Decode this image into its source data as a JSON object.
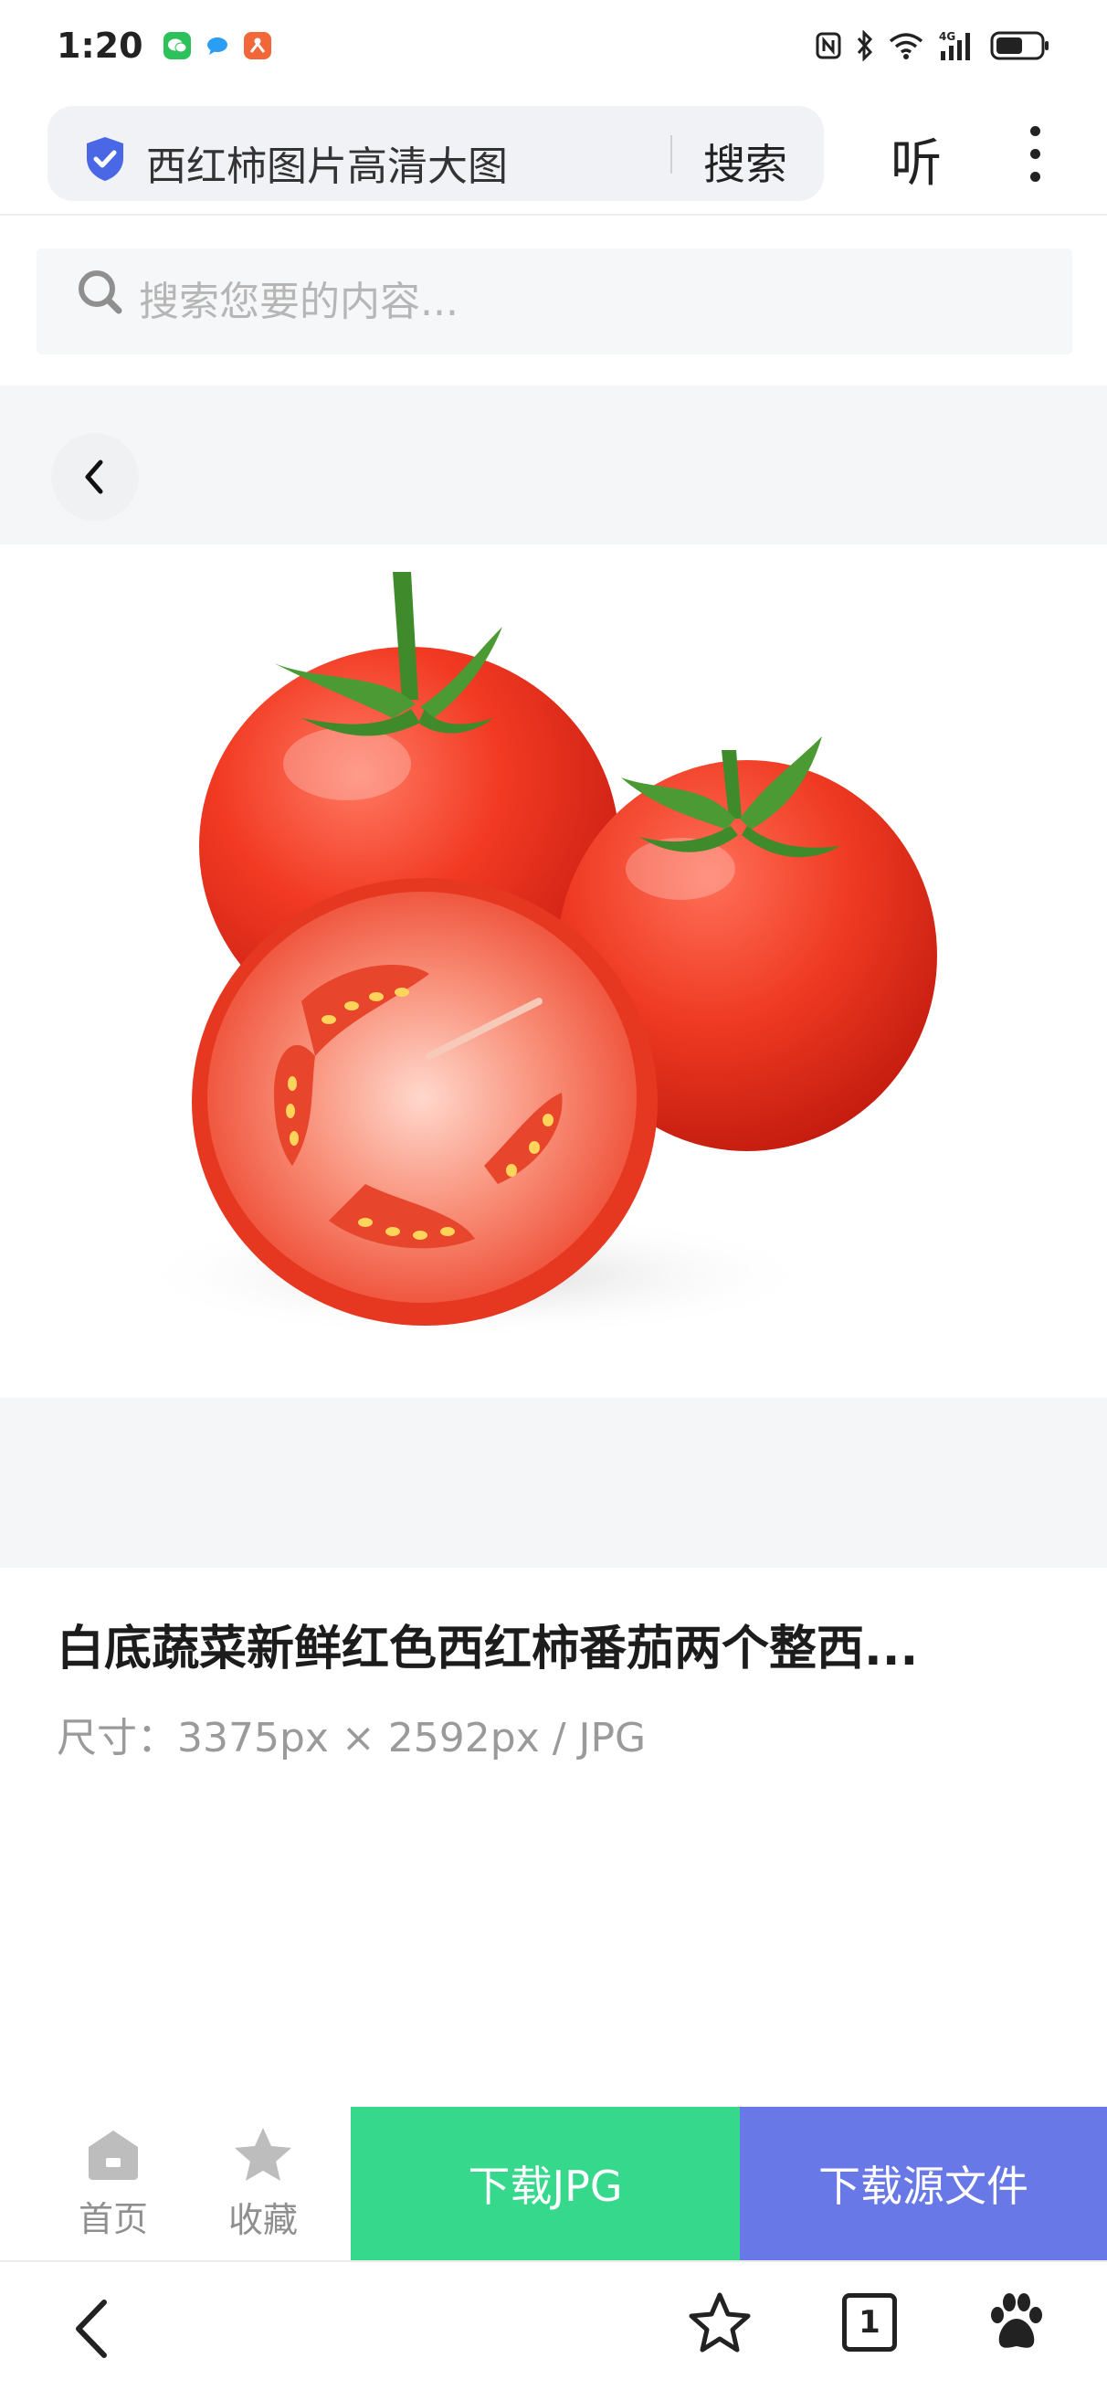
{
  "status_bar": {
    "time": "1:20",
    "apps": [
      {
        "icon": "wechat-icon",
        "color": "#2dc15b"
      },
      {
        "icon": "chat-bubble-icon",
        "color": "#2a9df4"
      },
      {
        "icon": "app-orange-icon",
        "color": "#f2673a"
      }
    ],
    "network_label": "4G",
    "icons": [
      "nfc-icon",
      "bluetooth-icon",
      "wifi-icon",
      "signal-icon",
      "battery-icon"
    ]
  },
  "address_bar": {
    "query": "西红柿图片高清大图",
    "search_label": "搜索",
    "listen_label": "听",
    "shield_color": "#4a68e6"
  },
  "site_search": {
    "placeholder": "搜索您要的内容..."
  },
  "image": {
    "title": "白底蔬菜新鲜红色西红柿番茄两个整西...",
    "size_text": "尺寸：3375px × 2592px / JPG"
  },
  "action_bar": {
    "home_label": "首页",
    "favorite_label": "收藏",
    "download_jpg_label": "下载JPG",
    "download_source_label": "下载源文件",
    "colors": {
      "jpg": "#36d88c",
      "source": "#6878e6"
    }
  },
  "browser_bar": {
    "tab_count": "1",
    "icons": [
      "back-arrow-icon",
      "star-icon",
      "tabs-icon",
      "paw-icon"
    ]
  }
}
